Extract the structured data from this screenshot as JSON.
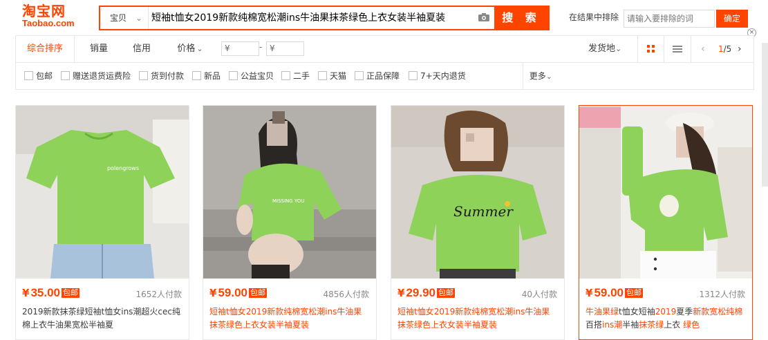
{
  "header": {
    "logo_cn": "淘宝网",
    "logo_en": "Taobao.com",
    "scope": "宝贝",
    "query": "短袖t恤女2019新款纯棉宽松潮ins牛油果抹茶绿色上衣女装半袖夏装",
    "search_button": "搜 索",
    "exclude_label": "在结果中排除",
    "exclude_placeholder": "请输入要排除的词",
    "exclude_button": "确定"
  },
  "sort": {
    "tabs": [
      "综合排序",
      "销量",
      "信用",
      "价格"
    ],
    "price_min_placeholder": "¥",
    "price_max_placeholder": "¥",
    "price_dash": "-",
    "ship_from": "发货地",
    "page_current": "1",
    "page_total": "/5"
  },
  "options": {
    "items": [
      "包邮",
      "赠送退货运费险",
      "货到付款",
      "新品",
      "公益宝贝",
      "二手",
      "天猫",
      "正品保障",
      "7+天内退货"
    ],
    "more": "更多"
  },
  "products": [
    {
      "price": "35.00",
      "baoyou": "包邮",
      "paid": "1652人付款",
      "title_parts": [
        "2019新款抹茶绿短袖t恤女ins潮超火cec纯棉上衣牛油果宽松半袖夏"
      ],
      "hl": [
        false
      ],
      "shirt_text": "polengrows"
    },
    {
      "price": "59.00",
      "baoyou": "包邮",
      "paid": "4856人付款",
      "title_parts": [
        "短袖t恤女2019新款纯棉宽松潮ins牛油果抹茶绿色上衣女装半袖夏装"
      ],
      "hl": [
        true
      ],
      "shirt_text": "MISSING YOU"
    },
    {
      "price": "29.90",
      "baoyou": "包邮",
      "paid": "40人付款",
      "title_parts": [
        "短袖t恤女2019新款纯棉宽松潮ins牛油果抹茶绿色上衣女装半袖夏装"
      ],
      "hl": [
        true
      ],
      "shirt_text": "Summer"
    },
    {
      "price": "59.00",
      "baoyou": "包邮",
      "paid": "1312人付款",
      "title_parts": [
        "牛油果绿",
        "t恤女短袖",
        "2019",
        "夏季",
        "新款宽松纯棉",
        "百搭",
        "ins潮",
        "半袖",
        "抹茶绿",
        "上衣 ",
        "绿色"
      ],
      "hl": [
        true,
        false,
        true,
        false,
        true,
        false,
        true,
        false,
        true,
        false,
        true
      ]
    }
  ],
  "colors": {
    "accent": "#ff4400",
    "shirt_green": "#8fd25a"
  },
  "currency": "¥"
}
